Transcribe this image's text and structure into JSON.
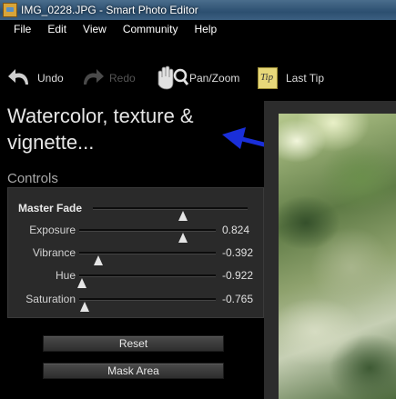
{
  "window": {
    "title": "IMG_0228.JPG - Smart Photo Editor"
  },
  "menu": [
    "File",
    "Edit",
    "View",
    "Community",
    "Help"
  ],
  "toolbar": {
    "undo": "Undo",
    "redo": "Redo",
    "pan_zoom": "Pan/Zoom",
    "last_tip": "Last Tip",
    "tip_badge": "Tip"
  },
  "effect": {
    "title": "Watercolor, texture & vignette..."
  },
  "controls": {
    "label": "Controls",
    "master_fade": {
      "label": "Master Fade",
      "position": 0.58
    },
    "sliders": [
      {
        "label": "Exposure",
        "value": "0.824",
        "position": 0.76
      },
      {
        "label": "Vibrance",
        "value": "-0.392",
        "position": 0.14
      },
      {
        "label": "Hue",
        "value": "-0.922",
        "position": 0.02
      },
      {
        "label": "Saturation",
        "value": "-0.765",
        "position": 0.04
      }
    ]
  },
  "buttons": {
    "reset": "Reset",
    "mask_area": "Mask Area"
  },
  "colors": {
    "arrow": "#1a2fd9",
    "panel_bg": "#2a2a2a",
    "titlebar": "#2c4f70"
  }
}
